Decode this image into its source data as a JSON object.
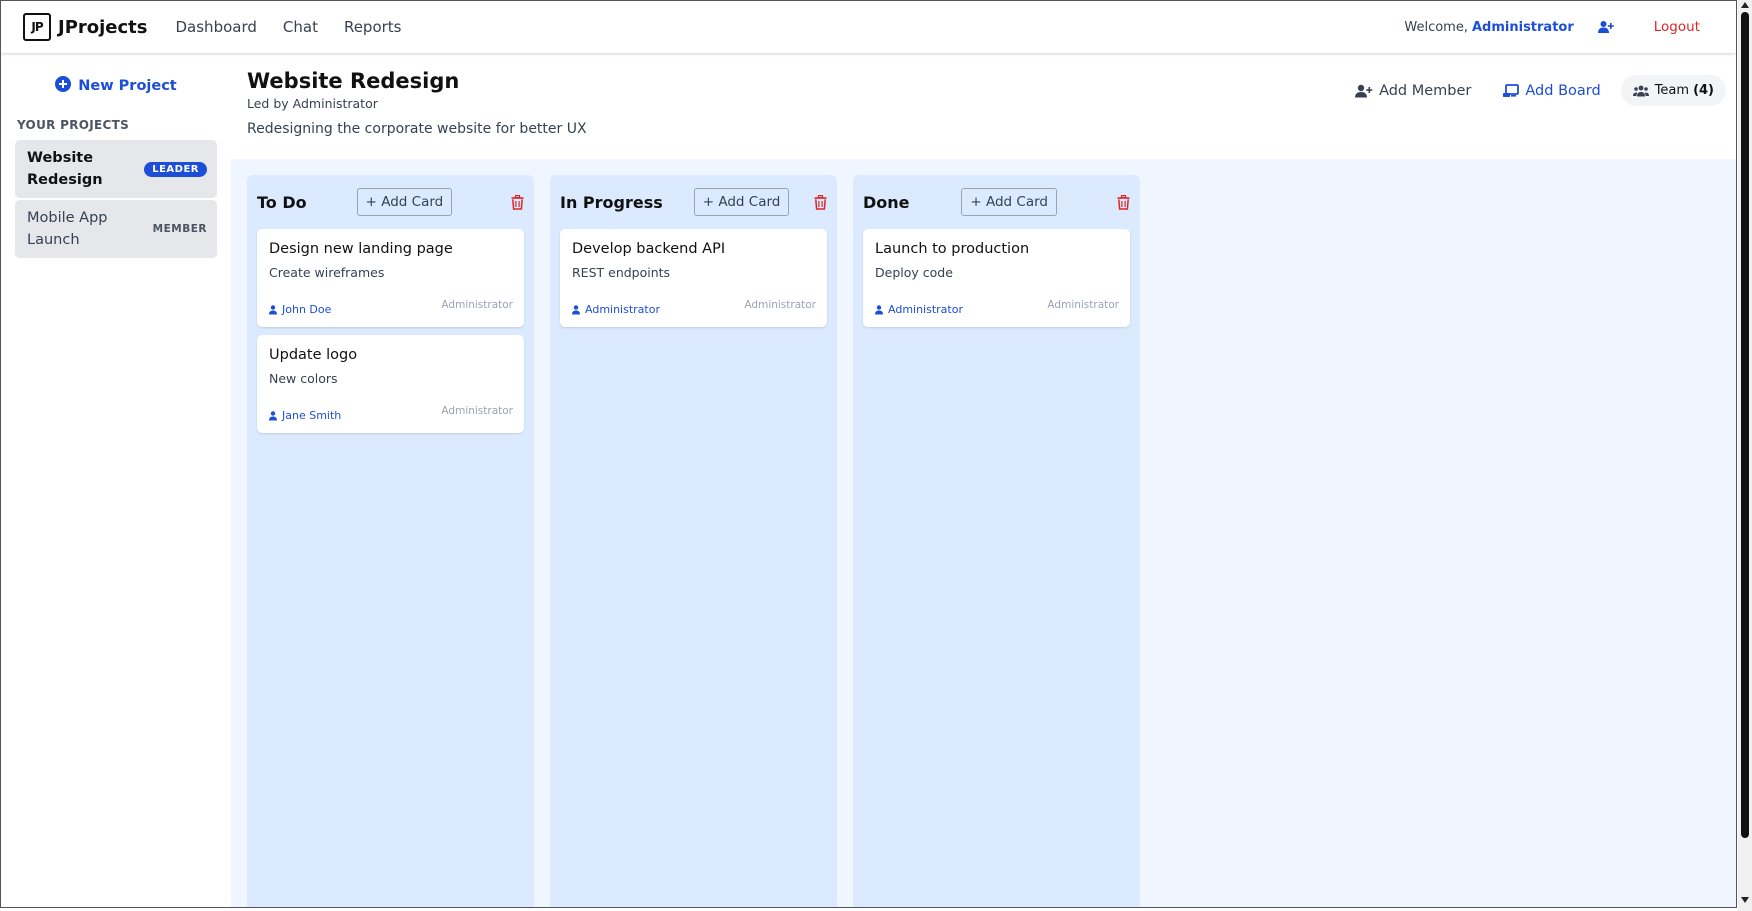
{
  "navbar": {
    "logo_text": "JP",
    "brand": "JProjects",
    "links": [
      "Dashboard",
      "Chat",
      "Reports"
    ],
    "welcome": "Welcome,",
    "user": "Administrator",
    "logout": "Logout"
  },
  "sidebar": {
    "new_project": "New Project",
    "section_title": "YOUR PROJECTS",
    "projects": [
      {
        "name": "Website Redesign",
        "role": "LEADER"
      },
      {
        "name": "Mobile App Launch",
        "role": "MEMBER"
      }
    ]
  },
  "project": {
    "title": "Website Redesign",
    "lead": "Led by Administrator",
    "description": "Redesigning the corporate website for better UX",
    "actions": {
      "add_member": "Add Member",
      "add_board": "Add Board",
      "team_label": "Team",
      "team_count": "(4)"
    }
  },
  "columns": [
    {
      "title": "To Do",
      "add_card": "+ Add Card",
      "cards": [
        {
          "title": "Design new landing page",
          "desc": "Create wireframes",
          "assignee": "John Doe",
          "author": "Administrator"
        },
        {
          "title": "Update logo",
          "desc": "New colors",
          "assignee": "Jane Smith",
          "author": "Administrator"
        }
      ]
    },
    {
      "title": "In Progress",
      "add_card": "+ Add Card",
      "cards": [
        {
          "title": "Develop backend API",
          "desc": "REST endpoints",
          "assignee": "Administrator",
          "author": "Administrator"
        }
      ]
    },
    {
      "title": "Done",
      "add_card": "+ Add Card",
      "cards": [
        {
          "title": "Launch to production",
          "desc": "Deploy code",
          "assignee": "Administrator",
          "author": "Administrator"
        }
      ]
    }
  ],
  "colors": {
    "accent": "#1d4ed8",
    "danger": "#dc2626",
    "column_bg": "#dbeafe",
    "board_bg": "#eff6ff"
  },
  "icons": {
    "brand": "jp-logo-icon",
    "nav_add_user": "user-plus-icon",
    "new_project": "plus-circle-icon",
    "add_member": "user-plus-icon",
    "add_board": "board-add-icon",
    "team": "users-icon",
    "column_delete": "trash-icon",
    "assignee": "user-icon"
  }
}
